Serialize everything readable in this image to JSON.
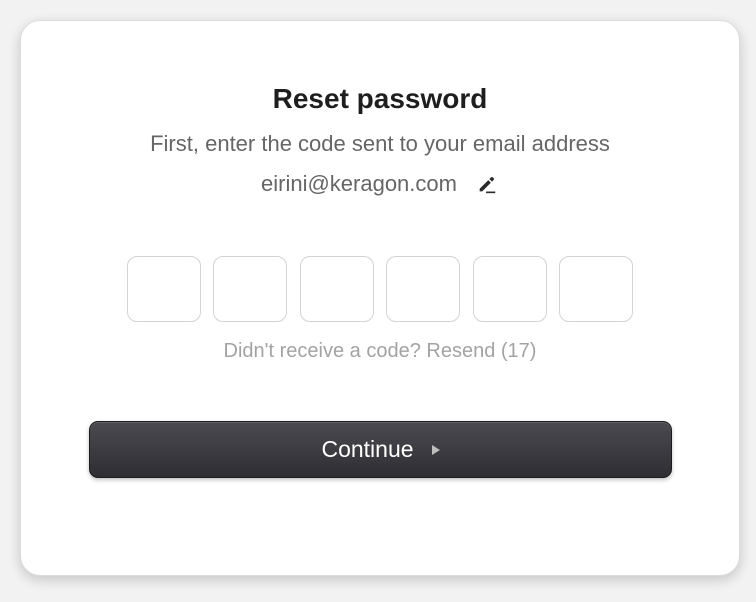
{
  "dialog": {
    "title": "Reset password",
    "subtitle": "First, enter the code sent to your email address",
    "email": "eirini@keragon.com",
    "edit_icon": "pencil-edit-icon"
  },
  "code_inputs": [
    "",
    "",
    "",
    "",
    "",
    ""
  ],
  "resend": {
    "prompt": "Didn't receive a code?",
    "link_label": "Resend",
    "countdown": "(17)"
  },
  "continue_button": {
    "label": "Continue",
    "icon": "play-arrow-icon"
  },
  "colors": {
    "button_bg": "#3a3a3f",
    "text_primary": "#1e1e1e",
    "text_secondary": "#666666",
    "text_muted": "#a3a3a3",
    "input_border": "#d3d3d3"
  }
}
